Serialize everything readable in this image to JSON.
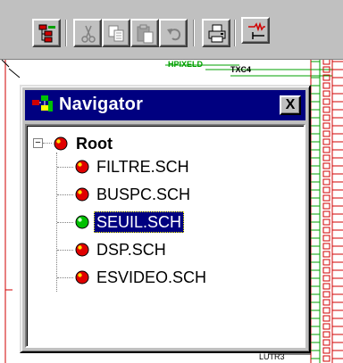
{
  "navigator": {
    "title": "Navigator",
    "close_glyph": "X",
    "root": {
      "label": "Root",
      "expander": "−",
      "status": "red"
    },
    "items": [
      {
        "label": "FILTRE.SCH",
        "status": "red",
        "selected": false
      },
      {
        "label": "BUSPC.SCH",
        "status": "red",
        "selected": false
      },
      {
        "label": "SEUIL.SCH",
        "status": "green",
        "selected": true
      },
      {
        "label": "DSP.SCH",
        "status": "red",
        "selected": false
      },
      {
        "label": "ESVIDEO.SCH",
        "status": "red",
        "selected": false
      }
    ]
  },
  "toolbar": {
    "buttons": [
      {
        "name": "hierarchy-icon",
        "enabled": true
      },
      {
        "name": "cut-icon",
        "enabled": false
      },
      {
        "name": "copy-icon",
        "enabled": false
      },
      {
        "name": "paste-icon",
        "enabled": false
      },
      {
        "name": "undo-icon",
        "enabled": false
      },
      {
        "name": "print-icon",
        "enabled": true
      },
      {
        "name": "wire-icon",
        "enabled": true
      }
    ]
  },
  "schematic": {
    "net_label_1": "HPIXELD",
    "net_label_2": "TXC4",
    "net_label_3": "LUTR3"
  },
  "colors": {
    "title_bar": "#000080",
    "selection": "#000080",
    "status_red": "#e00000",
    "status_green": "#00c000",
    "schematic_red": "#d00000",
    "schematic_green": "#00a000"
  }
}
